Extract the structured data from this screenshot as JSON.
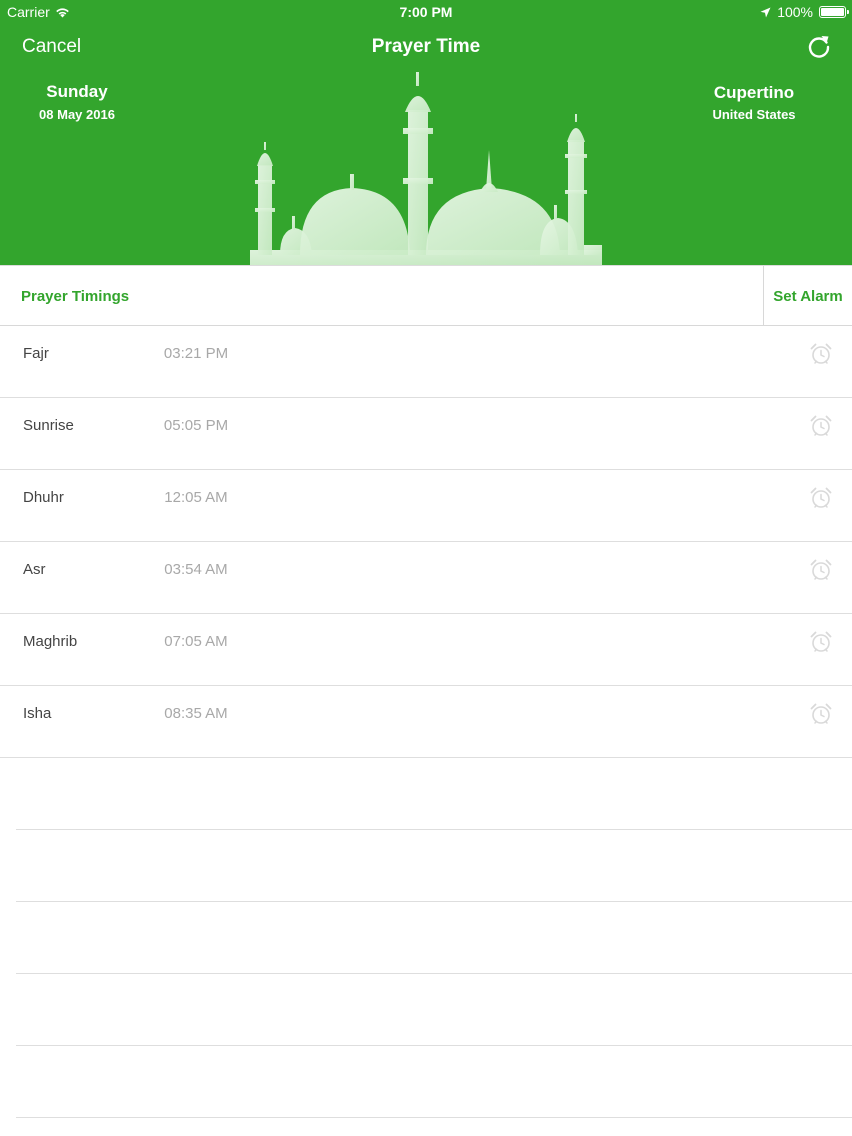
{
  "status_bar": {
    "carrier": "Carrier",
    "time": "7:00 PM",
    "battery": "100%"
  },
  "nav": {
    "cancel_label": "Cancel",
    "title": "Prayer Time",
    "refresh_icon": "refresh-icon"
  },
  "banner": {
    "day": "Sunday",
    "date": "08 May 2016",
    "city": "Cupertino",
    "country": "United States"
  },
  "section": {
    "left_label": "Prayer Timings",
    "right_label": "Set Alarm"
  },
  "prayers": [
    {
      "name": "Fajr",
      "time": "03:21 PM"
    },
    {
      "name": "Sunrise",
      "time": "05:05 PM"
    },
    {
      "name": "Dhuhr",
      "time": "12:05 AM"
    },
    {
      "name": "Asr",
      "time": "03:54 AM"
    },
    {
      "name": "Maghrib",
      "time": "07:05 AM"
    },
    {
      "name": "Isha",
      "time": "08:35 AM"
    }
  ],
  "colors": {
    "brand_green": "#33a52d",
    "mosque_tint": "#cfeccb",
    "alarm_icon": "#d9d9d9"
  }
}
